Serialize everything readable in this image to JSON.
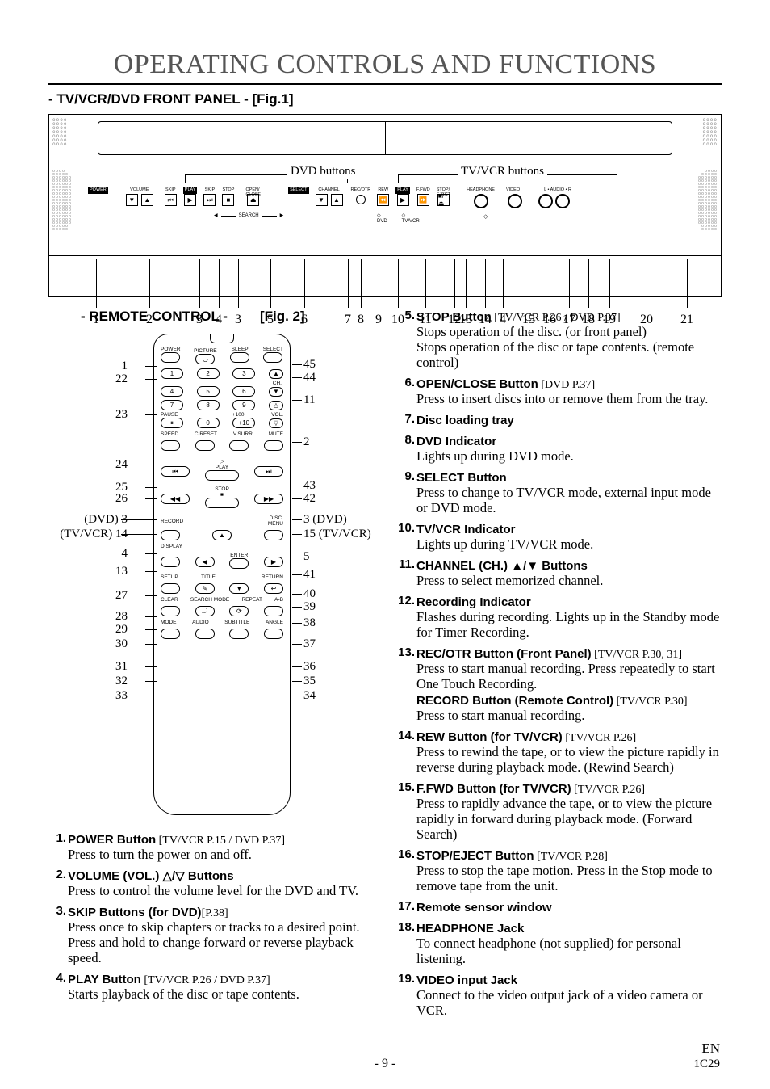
{
  "title": "OPERATING CONTROLS AND FUNCTIONS",
  "section1": "- TV/VCR/DVD FRONT PANEL - [Fig.1]",
  "panel": {
    "dvd_label": "DVD buttons",
    "tvvcr_label": "TV/VCR buttons",
    "labels": {
      "power": "POWER",
      "volume": "VOLUME",
      "skip": "SKIP",
      "play": "PLAY",
      "stop": "STOP",
      "openclose": "OPEN/\nCLOSE",
      "search": "SEARCH",
      "select": "SELECT",
      "channel": "CHANNEL",
      "recotr": "REC/OTR",
      "rew": "REW",
      "ffwd": "F.FWD",
      "stopeject": "STOP/\nEJECT",
      "headphone": "HEADPHONE",
      "video": "VIDEO",
      "audio": "L • AUDIO • R",
      "dvd_ind": "DVD",
      "tvvcr_ind": "TV/VCR"
    },
    "numbers": [
      "1",
      "2",
      "3",
      "4",
      "3",
      "5",
      "6",
      "7",
      "8",
      "9",
      "10",
      "11",
      "12",
      "13",
      "14",
      "4",
      "15",
      "16",
      "17",
      "18",
      "19",
      "20",
      "21"
    ]
  },
  "section2a": "- REMOTE CONTROL -",
  "section2b": "[Fig. 2]",
  "remote": {
    "labels": {
      "power": "POWER",
      "picture": "PICTURE",
      "sleep": "SLEEP",
      "select": "SELECT",
      "ch": "CH.",
      "pause": "PAUSE",
      "p100": "+100",
      "vol": "VOL.",
      "p10": "+10",
      "speed": "SPEED",
      "creset": "C.RESET",
      "vsurr": "V.SURR",
      "mute": "MUTE",
      "play": "PLAY",
      "stop": "STOP",
      "record": "RECORD",
      "discmenu": "DISC\nMENU",
      "display": "DISPLAY",
      "enter": "ENTER",
      "setup": "SETUP",
      "title": "TITLE",
      "return": "RETURN",
      "clear": "CLEAR",
      "searchmode": "SEARCH MODE",
      "repeat": "REPEAT",
      "ab": "A-B",
      "mode": "MODE",
      "audio": "AUDIO",
      "subtitle": "SUBTITLE",
      "angle": "ANGLE"
    },
    "leftNums": [
      "1",
      "22",
      "23",
      "24",
      "25",
      "26",
      "(DVD) 3",
      "(TV/VCR) 14",
      "4",
      "13",
      "27",
      "28",
      "29",
      "30",
      "31",
      "32",
      "33"
    ],
    "rightNums": [
      "45",
      "44",
      "11",
      "2",
      "43",
      "42",
      "3 (DVD)",
      "15 (TV/VCR)",
      "5",
      "41",
      "40",
      "39",
      "38",
      "37",
      "36",
      "35",
      "34"
    ]
  },
  "itemsLeft": [
    {
      "n": "1.",
      "hd": "POWER Button",
      "ref": " [TV/VCR P.15 / DVD P.37]",
      "desc": "Press to turn the power on and off."
    },
    {
      "n": "2.",
      "hd": "VOLUME (VOL.) △/▽ Buttons",
      "ref": "",
      "desc": "Press to control the volume level for the DVD and TV."
    },
    {
      "n": "3.",
      "hd": "SKIP Buttons (for DVD)",
      "ref": "[P.38]",
      "desc": "Press once to skip chapters or tracks to a desired point.\nPress and hold to change forward or reverse playback speed."
    },
    {
      "n": "4.",
      "hd": "PLAY Button",
      "ref": " [TV/VCR P.26 / DVD P.37]",
      "desc": "Starts playback of the disc or tape contents."
    }
  ],
  "itemsRight": [
    {
      "n": "5.",
      "hd": "STOP Button",
      "ref": " [TV/VCR P.26 / DVD P.37]",
      "desc": "Stops operation of the disc. (or front panel)\nStops operation of the disc or tape contents. (remote control)"
    },
    {
      "n": "6.",
      "hd": "OPEN/CLOSE Button",
      "ref": " [DVD P.37]",
      "desc": "Press to insert discs into or remove them from the tray."
    },
    {
      "n": "7.",
      "hd": "Disc loading tray",
      "ref": "",
      "desc": ""
    },
    {
      "n": "8.",
      "hd": "DVD Indicator",
      "ref": "",
      "desc": "Lights up during DVD mode."
    },
    {
      "n": "9.",
      "hd": "SELECT Button",
      "ref": "",
      "desc": "Press to change to TV/VCR mode, external input mode or DVD mode."
    },
    {
      "n": "10.",
      "hd": "TV/VCR Indicator",
      "ref": "",
      "desc": "Lights up during TV/VCR mode."
    },
    {
      "n": "11.",
      "hd": "CHANNEL (CH.) ▲/▼ Buttons",
      "ref": "",
      "desc": "Press to select memorized channel."
    },
    {
      "n": "12.",
      "hd": "Recording Indicator",
      "ref": "",
      "desc": "Flashes during recording. Lights up in the Standby mode for Timer Recording."
    },
    {
      "n": "13.",
      "hd": "REC/OTR Button (Front Panel)",
      "ref": " [TV/VCR P.30, 31]",
      "desc": "Press to start manual recording. Press repeatedly to start One Touch Recording.",
      "sub": {
        "hd": "RECORD Button (Remote Control)",
        "ref": " [TV/VCR P.30]",
        "desc": "Press to start manual recording."
      }
    },
    {
      "n": "14.",
      "hd": "REW Button (for TV/VCR)",
      "ref": " [TV/VCR P.26]",
      "desc": "Press to rewind the tape, or to view the picture rapidly in reverse during playback mode. (Rewind Search)"
    },
    {
      "n": "15.",
      "hd": "F.FWD Button (for TV/VCR)",
      "ref": " [TV/VCR P.26]",
      "desc": "Press to rapidly advance the tape, or to view the picture rapidly in forward during playback mode. (Forward Search)"
    },
    {
      "n": "16.",
      "hd": "STOP/EJECT Button",
      "ref": " [TV/VCR P.28]",
      "desc": "Press to stop the tape motion. Press in the Stop mode to remove tape from the unit."
    },
    {
      "n": "17.",
      "hd": "Remote sensor window",
      "ref": "",
      "desc": ""
    },
    {
      "n": "18.",
      "hd": "HEADPHONE Jack",
      "ref": "",
      "desc": "To connect headphone (not supplied) for personal listening."
    },
    {
      "n": "19.",
      "hd": "VIDEO input Jack",
      "ref": "",
      "desc": "Connect to the video output jack of a video camera or VCR."
    }
  ],
  "footer": {
    "page": "- 9 -",
    "lang": "EN",
    "code": "1C29"
  }
}
